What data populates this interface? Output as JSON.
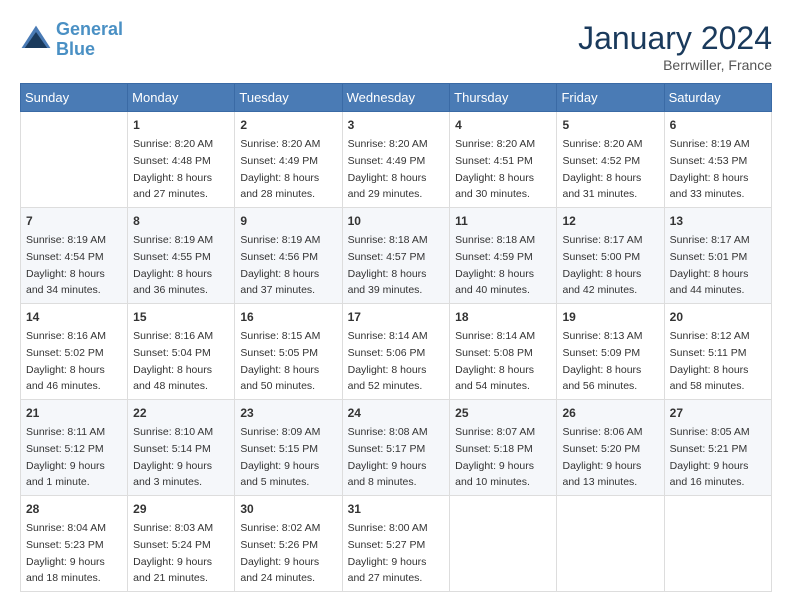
{
  "header": {
    "logo_line1": "General",
    "logo_line2": "Blue",
    "month": "January 2024",
    "location": "Berrwiller, France"
  },
  "days_of_week": [
    "Sunday",
    "Monday",
    "Tuesday",
    "Wednesday",
    "Thursday",
    "Friday",
    "Saturday"
  ],
  "weeks": [
    [
      {
        "day": "",
        "sunrise": "",
        "sunset": "",
        "daylight": ""
      },
      {
        "day": "1",
        "sunrise": "Sunrise: 8:20 AM",
        "sunset": "Sunset: 4:48 PM",
        "daylight": "Daylight: 8 hours and 27 minutes."
      },
      {
        "day": "2",
        "sunrise": "Sunrise: 8:20 AM",
        "sunset": "Sunset: 4:49 PM",
        "daylight": "Daylight: 8 hours and 28 minutes."
      },
      {
        "day": "3",
        "sunrise": "Sunrise: 8:20 AM",
        "sunset": "Sunset: 4:49 PM",
        "daylight": "Daylight: 8 hours and 29 minutes."
      },
      {
        "day": "4",
        "sunrise": "Sunrise: 8:20 AM",
        "sunset": "Sunset: 4:51 PM",
        "daylight": "Daylight: 8 hours and 30 minutes."
      },
      {
        "day": "5",
        "sunrise": "Sunrise: 8:20 AM",
        "sunset": "Sunset: 4:52 PM",
        "daylight": "Daylight: 8 hours and 31 minutes."
      },
      {
        "day": "6",
        "sunrise": "Sunrise: 8:19 AM",
        "sunset": "Sunset: 4:53 PM",
        "daylight": "Daylight: 8 hours and 33 minutes."
      }
    ],
    [
      {
        "day": "7",
        "sunrise": "Sunrise: 8:19 AM",
        "sunset": "Sunset: 4:54 PM",
        "daylight": "Daylight: 8 hours and 34 minutes."
      },
      {
        "day": "8",
        "sunrise": "Sunrise: 8:19 AM",
        "sunset": "Sunset: 4:55 PM",
        "daylight": "Daylight: 8 hours and 36 minutes."
      },
      {
        "day": "9",
        "sunrise": "Sunrise: 8:19 AM",
        "sunset": "Sunset: 4:56 PM",
        "daylight": "Daylight: 8 hours and 37 minutes."
      },
      {
        "day": "10",
        "sunrise": "Sunrise: 8:18 AM",
        "sunset": "Sunset: 4:57 PM",
        "daylight": "Daylight: 8 hours and 39 minutes."
      },
      {
        "day": "11",
        "sunrise": "Sunrise: 8:18 AM",
        "sunset": "Sunset: 4:59 PM",
        "daylight": "Daylight: 8 hours and 40 minutes."
      },
      {
        "day": "12",
        "sunrise": "Sunrise: 8:17 AM",
        "sunset": "Sunset: 5:00 PM",
        "daylight": "Daylight: 8 hours and 42 minutes."
      },
      {
        "day": "13",
        "sunrise": "Sunrise: 8:17 AM",
        "sunset": "Sunset: 5:01 PM",
        "daylight": "Daylight: 8 hours and 44 minutes."
      }
    ],
    [
      {
        "day": "14",
        "sunrise": "Sunrise: 8:16 AM",
        "sunset": "Sunset: 5:02 PM",
        "daylight": "Daylight: 8 hours and 46 minutes."
      },
      {
        "day": "15",
        "sunrise": "Sunrise: 8:16 AM",
        "sunset": "Sunset: 5:04 PM",
        "daylight": "Daylight: 8 hours and 48 minutes."
      },
      {
        "day": "16",
        "sunrise": "Sunrise: 8:15 AM",
        "sunset": "Sunset: 5:05 PM",
        "daylight": "Daylight: 8 hours and 50 minutes."
      },
      {
        "day": "17",
        "sunrise": "Sunrise: 8:14 AM",
        "sunset": "Sunset: 5:06 PM",
        "daylight": "Daylight: 8 hours and 52 minutes."
      },
      {
        "day": "18",
        "sunrise": "Sunrise: 8:14 AM",
        "sunset": "Sunset: 5:08 PM",
        "daylight": "Daylight: 8 hours and 54 minutes."
      },
      {
        "day": "19",
        "sunrise": "Sunrise: 8:13 AM",
        "sunset": "Sunset: 5:09 PM",
        "daylight": "Daylight: 8 hours and 56 minutes."
      },
      {
        "day": "20",
        "sunrise": "Sunrise: 8:12 AM",
        "sunset": "Sunset: 5:11 PM",
        "daylight": "Daylight: 8 hours and 58 minutes."
      }
    ],
    [
      {
        "day": "21",
        "sunrise": "Sunrise: 8:11 AM",
        "sunset": "Sunset: 5:12 PM",
        "daylight": "Daylight: 9 hours and 1 minute."
      },
      {
        "day": "22",
        "sunrise": "Sunrise: 8:10 AM",
        "sunset": "Sunset: 5:14 PM",
        "daylight": "Daylight: 9 hours and 3 minutes."
      },
      {
        "day": "23",
        "sunrise": "Sunrise: 8:09 AM",
        "sunset": "Sunset: 5:15 PM",
        "daylight": "Daylight: 9 hours and 5 minutes."
      },
      {
        "day": "24",
        "sunrise": "Sunrise: 8:08 AM",
        "sunset": "Sunset: 5:17 PM",
        "daylight": "Daylight: 9 hours and 8 minutes."
      },
      {
        "day": "25",
        "sunrise": "Sunrise: 8:07 AM",
        "sunset": "Sunset: 5:18 PM",
        "daylight": "Daylight: 9 hours and 10 minutes."
      },
      {
        "day": "26",
        "sunrise": "Sunrise: 8:06 AM",
        "sunset": "Sunset: 5:20 PM",
        "daylight": "Daylight: 9 hours and 13 minutes."
      },
      {
        "day": "27",
        "sunrise": "Sunrise: 8:05 AM",
        "sunset": "Sunset: 5:21 PM",
        "daylight": "Daylight: 9 hours and 16 minutes."
      }
    ],
    [
      {
        "day": "28",
        "sunrise": "Sunrise: 8:04 AM",
        "sunset": "Sunset: 5:23 PM",
        "daylight": "Daylight: 9 hours and 18 minutes."
      },
      {
        "day": "29",
        "sunrise": "Sunrise: 8:03 AM",
        "sunset": "Sunset: 5:24 PM",
        "daylight": "Daylight: 9 hours and 21 minutes."
      },
      {
        "day": "30",
        "sunrise": "Sunrise: 8:02 AM",
        "sunset": "Sunset: 5:26 PM",
        "daylight": "Daylight: 9 hours and 24 minutes."
      },
      {
        "day": "31",
        "sunrise": "Sunrise: 8:00 AM",
        "sunset": "Sunset: 5:27 PM",
        "daylight": "Daylight: 9 hours and 27 minutes."
      },
      {
        "day": "",
        "sunrise": "",
        "sunset": "",
        "daylight": ""
      },
      {
        "day": "",
        "sunrise": "",
        "sunset": "",
        "daylight": ""
      },
      {
        "day": "",
        "sunrise": "",
        "sunset": "",
        "daylight": ""
      }
    ]
  ]
}
